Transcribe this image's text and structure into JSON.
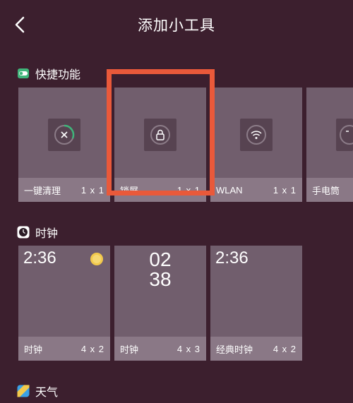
{
  "header": {
    "title": "添加小工具"
  },
  "sections": {
    "shortcuts": {
      "title": "快捷功能",
      "tiles": [
        {
          "label": "一键清理",
          "size": "1 x 1"
        },
        {
          "label": "锁屏",
          "size": "1 x 1"
        },
        {
          "label": "WLAN",
          "size": "1 x 1"
        },
        {
          "label": "手电筒",
          "size": ""
        }
      ]
    },
    "clock": {
      "title": "时钟",
      "tiles": [
        {
          "label": "时钟",
          "size": "4 x 2",
          "time": "2:36"
        },
        {
          "label": "时钟",
          "size": "4 x 3",
          "hour": "02",
          "minute": "38"
        },
        {
          "label": "经典时钟",
          "size": "4 x 2",
          "time": "2:36"
        }
      ]
    },
    "weather": {
      "title": "天气"
    }
  },
  "colors": {
    "background": "#3c1f2e",
    "tile": "#715e6d",
    "tile_footer": "#8a7886",
    "highlight": "#e9593a",
    "toggle_green": "#3fb57a",
    "sun": "#f2c94c"
  }
}
